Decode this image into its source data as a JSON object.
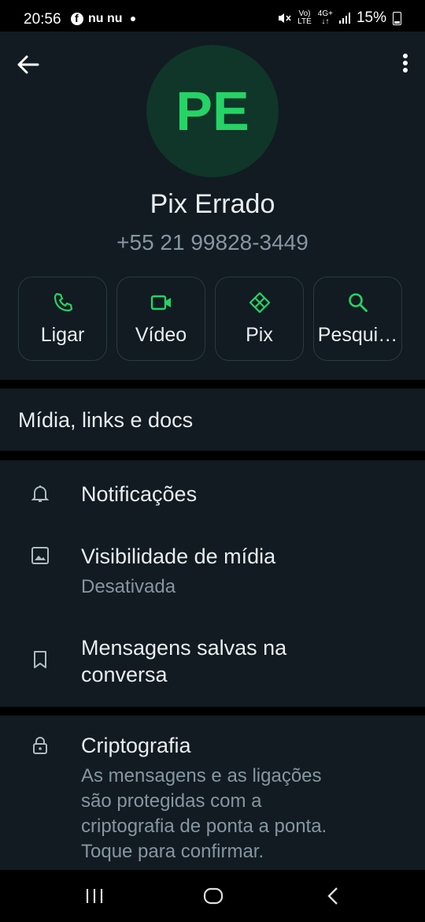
{
  "status_bar": {
    "time": "20:56",
    "facebook_glyph": "f",
    "carrier_text": "nu nu",
    "volte_top": "Vo)",
    "volte_bottom": "LTE",
    "network_top": "4G+",
    "network_bottom": "↓↑",
    "battery": "15%"
  },
  "contact": {
    "avatar_initials": "PE",
    "name": "Pix Errado",
    "phone": "+55 21 99828-3449"
  },
  "actions": [
    {
      "label": "Ligar",
      "icon": "phone-icon"
    },
    {
      "label": "Vídeo",
      "icon": "video-icon"
    },
    {
      "label": "Pix",
      "icon": "pix-icon"
    },
    {
      "label": "Pesqui…",
      "icon": "search-icon"
    }
  ],
  "media": {
    "label": "Mídia, links e docs"
  },
  "settings": {
    "notifications": {
      "title": "Notificações"
    },
    "media_visibility": {
      "title": "Visibilidade de mídia",
      "subtitle": "Desativada"
    },
    "saved_messages": {
      "title_line1": "Mensagens salvas na",
      "title_line2": "conversa"
    }
  },
  "encryption": {
    "title": "Criptografia",
    "line1": "As mensagens e as ligações",
    "line2": "são protegidas com a",
    "line3": "criptografia de ponta a ponta.",
    "line4": "Toque para confirmar."
  },
  "colors": {
    "accent": "#25d366",
    "panel": "#111b21",
    "avatar_bg": "#103529",
    "secondary_text": "#8696a0"
  }
}
